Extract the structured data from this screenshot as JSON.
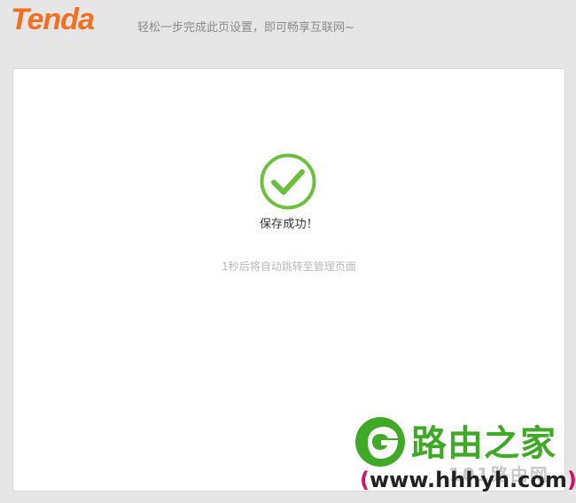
{
  "header": {
    "logo_text": "Tenda",
    "tagline": "轻松一步完成此页设置，即可畅享互联网~"
  },
  "status": {
    "success_text": "保存成功！",
    "redirect_text": "1秒后将自动跳转至管理页面"
  },
  "watermark": {
    "brand": "路由之家",
    "sub": "101路由网",
    "url_open": "(",
    "url": "www.hhhyh.com",
    "url_close": ")"
  },
  "colors": {
    "brand_orange": "#f36f21",
    "success_green": "#6fbf3e",
    "watermark_green": "#41a928"
  },
  "icons": {
    "success": "check-circle-icon"
  }
}
